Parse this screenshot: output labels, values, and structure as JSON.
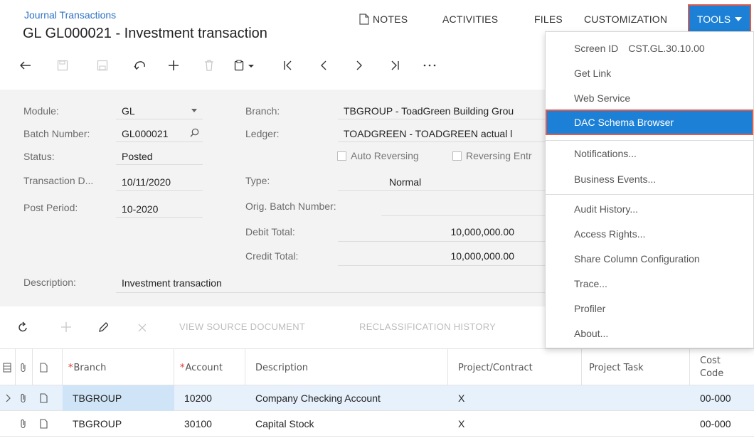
{
  "header": {
    "breadcrumb": "Journal Transactions",
    "title": "GL GL000021 - Investment transaction",
    "menu": {
      "notes": "NOTES",
      "activities": "ACTIVITIES",
      "files": "FILES",
      "customization": "CUSTOMIZATION",
      "tools": "TOOLS"
    }
  },
  "form": {
    "module_label": "Module:",
    "module_value": "GL",
    "batch_label": "Batch Number:",
    "batch_value": "GL000021",
    "status_label": "Status:",
    "status_value": "Posted",
    "trandate_label": "Transaction D...",
    "trandate_value": "10/11/2020",
    "postperiod_label": "Post Period:",
    "postperiod_value": "10-2020",
    "branch_label": "Branch:",
    "branch_value": "TBGROUP - ToadGreen Building Grou",
    "ledger_label": "Ledger:",
    "ledger_value": "TOADGREEN - TOADGREEN actual l",
    "auto_reversing": "Auto Reversing",
    "reversing_entry": "Reversing Entr",
    "type_label": "Type:",
    "type_value": "Normal",
    "orig_batch_label": "Orig. Batch Number:",
    "debit_label": "Debit Total:",
    "debit_value": "10,000,000.00",
    "credit_label": "Credit Total:",
    "credit_value": "10,000,000.00",
    "description_label": "Description:",
    "description_value": "Investment transaction"
  },
  "grid_toolbar": {
    "view_source": "VIEW SOURCE DOCUMENT",
    "reclass_history": "RECLASSIFICATION HISTORY"
  },
  "grid": {
    "headers": {
      "branch": "Branch",
      "account": "Account",
      "description": "Description",
      "project": "Project/Contract",
      "task": "Project Task",
      "cost_code_1": "Cost",
      "cost_code_2": "Code"
    },
    "rows": [
      {
        "branch": "TBGROUP",
        "account": "10200",
        "description": "Company Checking Account",
        "project": "X",
        "cost_code": "00-000"
      },
      {
        "branch": "TBGROUP",
        "account": "30100",
        "description": "Capital Stock",
        "project": "X",
        "cost_code": "00-000"
      }
    ]
  },
  "tools_menu": {
    "screen_id_label": "Screen ID",
    "screen_id_value": "CST.GL.30.10.00",
    "items": [
      "Get Link",
      "Web Service",
      "DAC Schema Browser",
      "Notifications...",
      "Business Events...",
      "Audit History...",
      "Access Rights...",
      "Share Column Configuration",
      "Trace...",
      "Profiler",
      "About..."
    ]
  },
  "colors": {
    "accent": "#1c81d6",
    "highlight_border": "#e05a4a",
    "link": "#2d73c2",
    "selected_row": "#e6f1fb"
  }
}
